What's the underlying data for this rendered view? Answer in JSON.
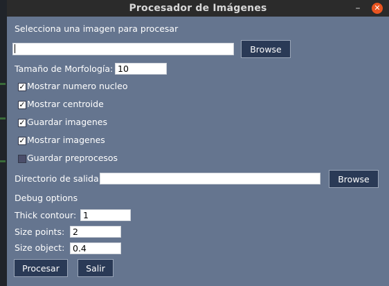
{
  "window": {
    "title": "Procesador de Imágenes"
  },
  "input": {
    "select_label": "Selecciona una imagen para procesar",
    "image_path": "",
    "browse_label": "Browse"
  },
  "morphology": {
    "label": "Tamaño de Morfología:",
    "value": "10"
  },
  "options": [
    {
      "label": "Mostrar numero nucleo",
      "checked": true
    },
    {
      "label": "Mostrar centroide",
      "checked": true
    },
    {
      "label": "Guardar imagenes",
      "checked": true
    },
    {
      "label": "Mostrar imagenes",
      "checked": true
    },
    {
      "label": "Guardar preprocesos",
      "checked": false
    }
  ],
  "output": {
    "label": "Directorio de salida",
    "path": "",
    "browse_label": "Browse"
  },
  "debug": {
    "title": "Debug options",
    "thick_contour_label": "Thick contour:",
    "thick_contour_value": "1",
    "size_points_label": "Size points:",
    "size_points_value": "2",
    "size_object_label": "Size object:",
    "size_object_value": "0.4"
  },
  "actions": {
    "process_label": "Procesar",
    "exit_label": "Salir"
  },
  "icons": {
    "minimize": "minimize-icon",
    "close": "close-icon",
    "check": "checkmark-icon"
  }
}
